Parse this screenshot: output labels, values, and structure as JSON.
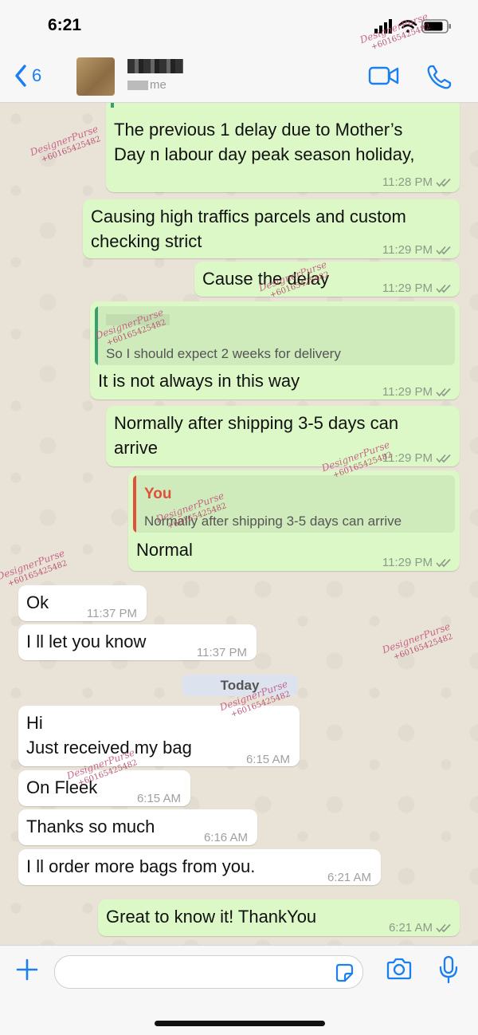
{
  "status_bar": {
    "time": "6:21"
  },
  "header": {
    "back_count": "6",
    "subtitle_suffix": "me"
  },
  "colors": {
    "accent": "#1a7ff0",
    "outgoing": "#dcf8c6",
    "incoming": "#ffffff",
    "reply_name": "#e0513a",
    "reply_bar_self": "#e0513a",
    "reply_bar_other": "#3b9e6e"
  },
  "messages": [
    {
      "dir": "out",
      "text": "The previous 1 delay due to Mother’s\nDay n labour day peak season holiday,",
      "time": "11:28 PM",
      "read": true
    },
    {
      "dir": "out",
      "text": "Causing high traffics parcels and custom\nchecking strict",
      "time": "11:29 PM",
      "read": true
    },
    {
      "dir": "out",
      "text": "Cause the delay",
      "time": "11:29 PM",
      "read": true
    },
    {
      "dir": "out",
      "quote_text": "So I should expect 2 weeks for delivery",
      "text": "It is not always in this way",
      "time": "11:29 PM",
      "read": true
    },
    {
      "dir": "out",
      "text": "Normally after shipping 3-5 days can\narrive",
      "time": "11:29 PM",
      "read": true
    },
    {
      "dir": "out",
      "quote_name": "You",
      "quote_text": "Normally after shipping 3-5 days can arrive",
      "text": "Normal",
      "time": "11:29 PM",
      "read": true
    },
    {
      "dir": "in",
      "text": "Ok",
      "time": "11:37 PM"
    },
    {
      "dir": "in",
      "text": "I ll let you know",
      "time": "11:37 PM"
    },
    {
      "dir": "in",
      "text": "Hi\nJust received my bag",
      "time": "6:15 AM"
    },
    {
      "dir": "in",
      "text": "On Fleek",
      "time": "6:15 AM"
    },
    {
      "dir": "in",
      "text": "Thanks so much",
      "time": "6:16 AM"
    },
    {
      "dir": "in",
      "text": "I ll order more bags from you.",
      "time": "6:21 AM"
    },
    {
      "dir": "out",
      "text": "Great to know it! ThankYou",
      "time": "6:21 AM",
      "read": true
    }
  ],
  "date_divider": "Today",
  "watermark": {
    "brand": "DesignerPurse",
    "phone": "+60165425482"
  },
  "icons": [
    "back-chevron-icon",
    "video-call-icon",
    "phone-icon",
    "plus-icon",
    "sticker-icon",
    "camera-icon",
    "mic-icon",
    "read-ticks-icon",
    "signal-icon",
    "wifi-icon",
    "battery-icon"
  ]
}
